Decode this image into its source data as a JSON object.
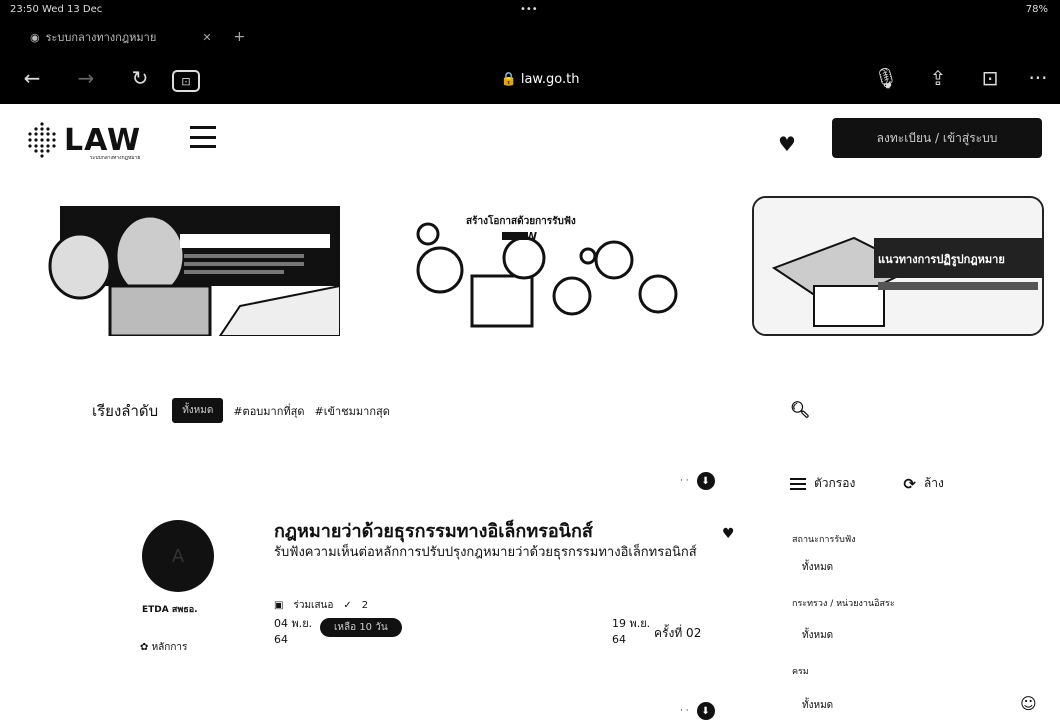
{
  "browser": {
    "status_time": "23:50  Wed 13 Dec",
    "status_center": "•••",
    "status_battery": "78%",
    "tab_title": "ระบบกลางทางกฎหมาย",
    "tab_close": "✕",
    "tab_add": "+",
    "url": "🔒 law.go.th",
    "back": "←",
    "forward": "→",
    "reload": "↻",
    "tab_icon": "⊡",
    "mic": "🎙",
    "share": "⇪",
    "tabs_btn": "⊡",
    "more": "···"
  },
  "header": {
    "logo_text": "LAW",
    "logo_sub": "ระบบกลางทางกฎหมาย",
    "login_label": "ลงทะเบียน / เข้าสู่ระบบ"
  },
  "banners": {
    "b2_title": "สร้างโอกาสด้วยการรับฟัง",
    "b2_brand": "LAW",
    "b3_title": "แนวทางการปฏิรูปกฎหมาย"
  },
  "sort": {
    "label": "เรียงลำดับ",
    "options": [
      "ทั้งหมด",
      "#ตอบมากที่สุด",
      "#เข้าชมมากสุด"
    ]
  },
  "filters": {
    "menu_label": "ตัวกรอง",
    "clear_label": "ล้าง",
    "groups": [
      {
        "label": "สถานะการรับฟัง",
        "value": "ทั้งหมด"
      },
      {
        "label": "กระทรวง / หน่วยงานอิสระ",
        "value": "ทั้งหมด"
      },
      {
        "label": "ครม",
        "value": "ทั้งหมด"
      }
    ]
  },
  "card": {
    "title": "กฎหมายว่าด้วยธุรกรรมทางอิเล็กทรอนิกส์",
    "description": "รับฟังความเห็นต่อหลักการปรับปรุงกฎหมายว่าด้วยธุรกรรมทางอิเล็กทรอนิกส์",
    "org_name": "ETDA สพธอ.",
    "org_tag": "หลักการ",
    "meta_comments": "ร่วมเสนอ",
    "meta_count": "2",
    "start_date": "04 พ.ย.",
    "start_year": "64",
    "remaining": "เหลือ 10 วัน",
    "end_date": "19 พ.ย.",
    "end_year": "64",
    "round": "ครั้งที่ 02"
  },
  "pager": {
    "dots": "· ·"
  }
}
